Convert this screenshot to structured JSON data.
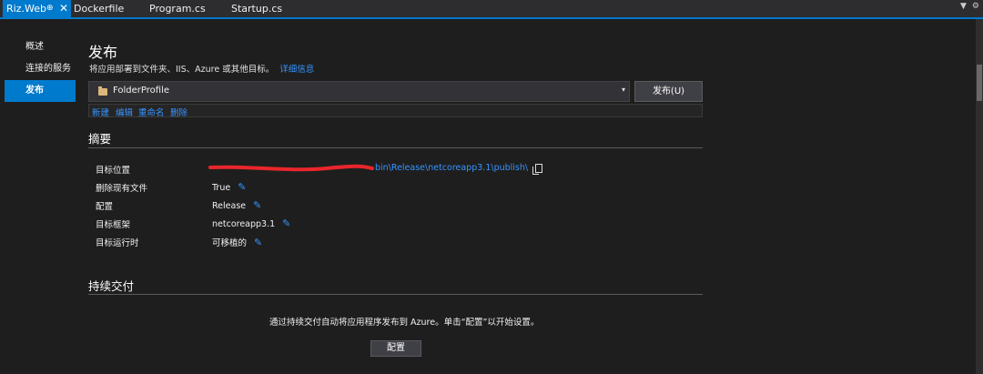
{
  "tabs": [
    {
      "label": "Riz.Web",
      "active": true,
      "pin_icon": "pin-icon",
      "close_icon": "close-icon"
    },
    {
      "label": "Dockerfile"
    },
    {
      "label": "Program.cs"
    },
    {
      "label": "Startup.cs"
    }
  ],
  "sidebar": {
    "items": [
      {
        "label": "概述"
      },
      {
        "label": "连接的服务"
      },
      {
        "label": "发布",
        "active": true
      }
    ]
  },
  "main": {
    "title": "发布",
    "subtitle": "将应用部署到文件夹、IIS、Azure 或其他目标。",
    "details_link": "详细信息",
    "profile": {
      "name": "FolderProfile",
      "icon": "folder-icon"
    },
    "publish_button": "发布(U)",
    "actions": {
      "new": "新建",
      "edit": "编辑",
      "rename": "重命名",
      "delete": "删除"
    }
  },
  "summary": {
    "title": "摘要",
    "rows": [
      {
        "label": "目标位置",
        "value": "bin\\Release\\netcoreapp3.1\\publish\\"
      },
      {
        "label": "删除现有文件",
        "value": "True"
      },
      {
        "label": "配置",
        "value": "Release"
      },
      {
        "label": "目标框架",
        "value": "netcoreapp3.1"
      },
      {
        "label": "目标运行时",
        "value": "可移植的"
      }
    ]
  },
  "continuous_delivery": {
    "title": "持续交付",
    "text": "通过持续交付自动将应用程序发布到 Azure。单击“配置”以开始设置。",
    "button": "配置"
  },
  "colors": {
    "accent": "#007acc",
    "link": "#3794ff",
    "background": "#1e1e1e",
    "redaction": "#e8262b"
  }
}
